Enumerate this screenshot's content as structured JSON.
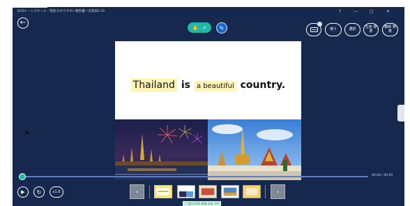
{
  "window": {
    "title": "DVDシートスクール - 英語 わかりやすい教科書ー天英語2 20",
    "controls": {
      "help": "?",
      "minimize": "—",
      "maximize": "□",
      "close": "✕"
    }
  },
  "toolbar": {
    "back_icon": "arrow-left-icon",
    "pointer_icon": "hand-pointer-icon",
    "pen_icon": "pen-icon",
    "buttons": [
      {
        "label": ""
      },
      {
        "label": "使う"
      },
      {
        "label": "選択"
      },
      {
        "label": "生徒 発表"
      },
      {
        "label": "教師 発表"
      }
    ]
  },
  "slide": {
    "sentence": [
      {
        "text": "Thailand",
        "highlighted": true,
        "style": "big"
      },
      {
        "text": "is",
        "highlighted": false,
        "style": "bold"
      },
      {
        "text": "a beautiful",
        "highlighted": true,
        "style": "small"
      },
      {
        "text": "country.",
        "highlighted": false,
        "style": "bold"
      }
    ],
    "images": [
      {
        "subject": "fireworks-over-temple-night"
      },
      {
        "subject": "golden-temple-day"
      }
    ]
  },
  "player": {
    "time": "00:00 / 00:05",
    "progress": 0.0,
    "play_icon": "play-icon",
    "loop_icon": "loop-icon",
    "speed": "x1.0"
  },
  "thumbnails": {
    "prev_icon": "chevron-left-icon",
    "next_icon": "chevron-right-icon",
    "items": [
      {
        "active": true
      },
      {
        "active": false
      },
      {
        "active": false
      },
      {
        "active": false
      },
      {
        "active": false
      }
    ],
    "page_label": "□ 読む(1/6) 単語 本文 1/6"
  },
  "colors": {
    "app_bg": "#16284e",
    "accent_teal": "#1fb8a8",
    "accent_blue": "#1f64c8",
    "highlight": "#fdf5b6",
    "progress": "#5a7dd4"
  }
}
